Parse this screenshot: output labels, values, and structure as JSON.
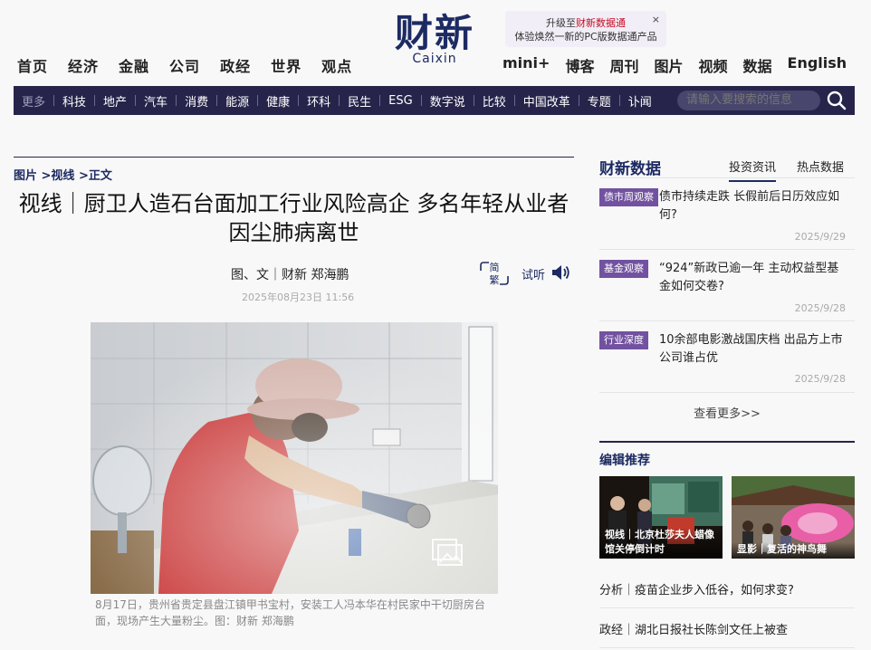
{
  "header": {
    "nav_left": [
      "首页",
      "经济",
      "金融",
      "公司",
      "政经",
      "世界",
      "观点"
    ],
    "nav_right": [
      "mini+",
      "博客",
      "周刊",
      "图片",
      "视频",
      "数据",
      "English"
    ],
    "logo_cn": "财新",
    "logo_en": "Caixin",
    "promo_prefix": "升级至",
    "promo_highlight": "财新数据通",
    "promo_line2": "体验焕然一新的PC版数据通产品",
    "promo_close": "×"
  },
  "subnav": {
    "items": [
      "更多",
      "科技",
      "地产",
      "汽车",
      "消费",
      "能源",
      "健康",
      "环科",
      "民生",
      "ESG",
      "数字说",
      "比较",
      "中国改革",
      "专题",
      "讣闻"
    ],
    "search_placeholder": "请输入要搜索的信息"
  },
  "article": {
    "breadcrumb": "图片 >视线 >正文",
    "title": "视线｜厨卫人造石台面加工行业风险高企 多名年轻从业者因尘肺病离世",
    "byline": "图、文｜财新 郑海鹏",
    "date": "2025年08月23日 11:56",
    "simp_trad_top": "简",
    "simp_trad_bottom": "繁",
    "listen_label": "试听",
    "caption": "8月17日，贵州省贵定县盘江镇甲书宝村，安装工人冯本华在村民家中干切厨房台面，现场产生大量粉尘。图：财新 郑海鹏"
  },
  "sidebar": {
    "data_title": "财新数据",
    "tabs": [
      "投资资讯",
      "热点数据"
    ],
    "items": [
      {
        "badge": "债市周观察",
        "text": "债市持续走跌 长假前后日历效应如何?",
        "date": "2025/9/29"
      },
      {
        "badge": "基金观察",
        "text": "“924”新政已逾一年 主动权益型基金如何交卷?",
        "date": "2025/9/28"
      },
      {
        "badge": "行业深度",
        "text": "10余部电影激战国庆档 出品方上市公司谁占优",
        "date": "2025/9/28"
      }
    ],
    "more": "查看更多>>",
    "editor_title": "编辑推荐",
    "thumbs": [
      {
        "caption": "视线｜北京杜莎夫人蜡像馆关停倒计时"
      },
      {
        "caption": "显影｜复活的神鸟舞"
      }
    ],
    "recommend": [
      "分析｜疫苗企业步入低谷，如何求变?",
      "政经｜湖北日报社长陈剑文任上被查"
    ]
  },
  "colors": {
    "navy": "#1d2b63",
    "subbar": "#26244a",
    "badge": "#7252a0"
  }
}
